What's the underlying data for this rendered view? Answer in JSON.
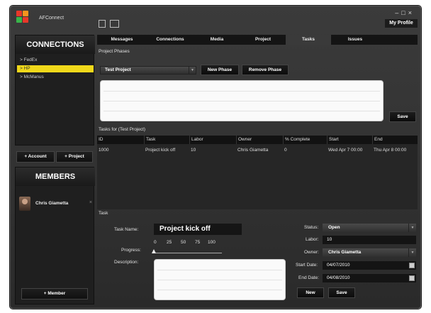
{
  "window": {
    "app_name": "AFConnect",
    "controls": {
      "minimize": "–",
      "maximize": "□",
      "close": "×"
    },
    "my_profile": "My Profile"
  },
  "sidebar": {
    "connections_title": "CONNECTIONS",
    "connections": [
      {
        "label": "> FedEx",
        "active": false
      },
      {
        "label": "> HP",
        "active": true
      },
      {
        "label": "> McManus",
        "active": false
      }
    ],
    "add_account": "+ Account",
    "add_project": "+ Project",
    "members_title": "MEMBERS",
    "members": [
      {
        "name": "Chris Giametta",
        "remove": "×"
      }
    ],
    "add_member": "+ Member"
  },
  "tabs": [
    "Messages",
    "Connections",
    "Media",
    "Project",
    "Tasks",
    "Issues"
  ],
  "active_tab": "Tasks",
  "phases": {
    "section_label": "Project Phases",
    "selected_project": "Test Project",
    "new_phase": "New Phase",
    "remove_phase": "Remove Phase",
    "save": "Save"
  },
  "tasks": {
    "section_label": "Tasks for (Test Project)",
    "columns": [
      "ID",
      "Task",
      "Labor",
      "Owner",
      "% Complete",
      "Start",
      "End"
    ],
    "rows": [
      {
        "id": "1000",
        "task": "Project kick off",
        "labor": "10",
        "owner": "Chris Giametta",
        "complete": "0",
        "start": "Wed Apr 7 00:00",
        "end": "Thu Apr 8 00:00"
      }
    ]
  },
  "task_form": {
    "section_label": "Task",
    "task_name_label": "Task Name:",
    "task_name": "Project kick off",
    "progress_label": "Progress:",
    "progress_ticks": [
      "0",
      "25",
      "50",
      "75",
      "100"
    ],
    "progress_value": 0,
    "description_label": "Description:",
    "status_label": "Status:",
    "status": "Open",
    "labor_label": "Labor:",
    "labor": "10",
    "owner_label": "Owner:",
    "owner": "Chris Giametta",
    "start_label": "Start Date:",
    "start_date": "04/07/2010",
    "end_label": "End Date:",
    "end_date": "04/08/2010",
    "new": "New",
    "save": "Save"
  },
  "colors": {
    "accent_yellow": "#f0d81a",
    "background": "#2f2f2f"
  }
}
